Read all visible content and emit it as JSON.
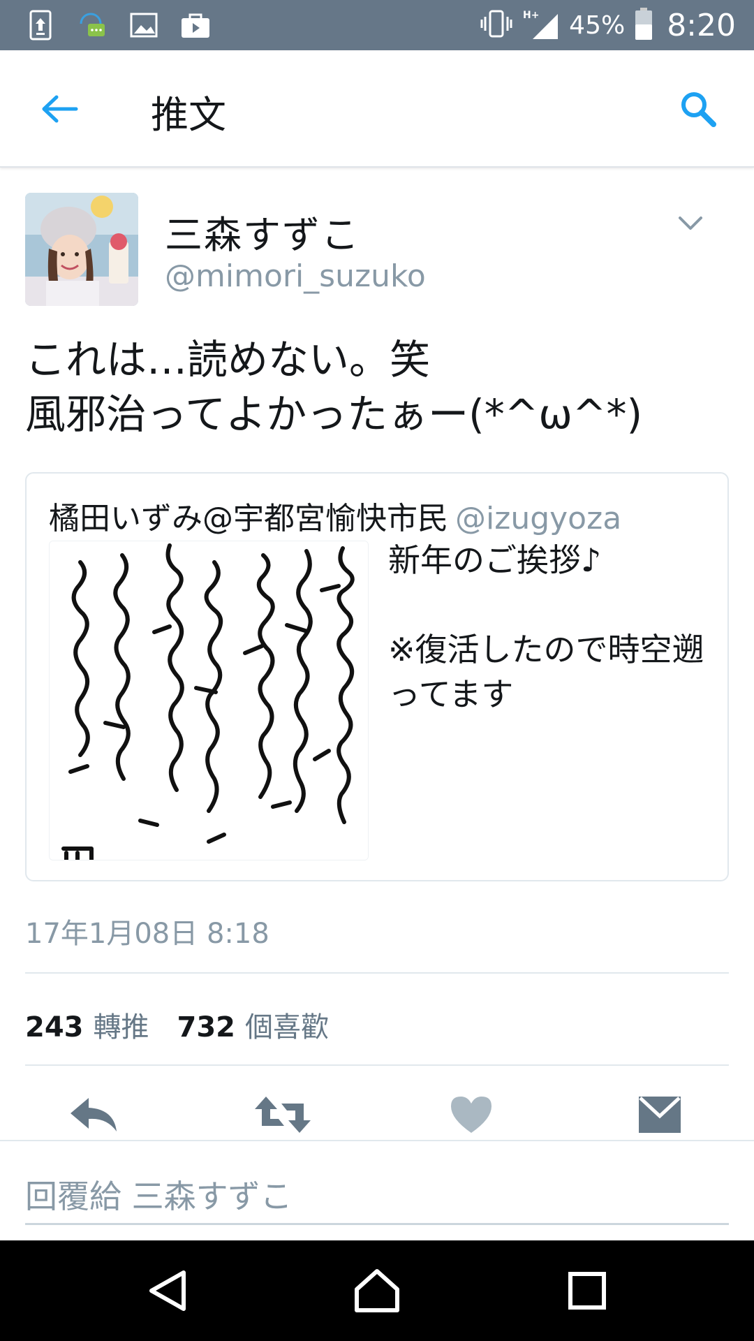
{
  "status_bar": {
    "battery": "45%",
    "time": "8:20",
    "network": "H+",
    "icons": [
      "upload-icon",
      "chat-icon",
      "image-icon",
      "store-icon",
      "vibrate-icon",
      "signal-icon",
      "battery-icon"
    ]
  },
  "header": {
    "title": "推文",
    "back_icon": "arrow-left-icon",
    "search_icon": "search-icon"
  },
  "tweet": {
    "author_name": "三森すずこ",
    "author_handle": "@mimori_suzuko",
    "text_line1": "これは…読めない。笑",
    "text_line2": "風邪治ってよかったぁー(*^ω^*)",
    "timestamp": "17年1月08日 8:18",
    "retweets_count": "243",
    "retweets_label": "轉推",
    "likes_count": "732",
    "likes_label": "個喜歡"
  },
  "quoted_tweet": {
    "name": "橘田いずみ@宇都宮愉快市民",
    "handle": "@izugyoza",
    "text": "新年のご挨拶♪\n\n※復活したので時空遡ってます"
  },
  "actions": [
    "reply-icon",
    "retweet-icon",
    "like-icon",
    "direct-message-icon"
  ],
  "reply": {
    "placeholder": "回覆給 三森すずこ"
  },
  "colors": {
    "accent": "#1da1f2",
    "status_bar": "#667788",
    "muted_text": "#8899a6",
    "icon_gray": "#657786"
  }
}
